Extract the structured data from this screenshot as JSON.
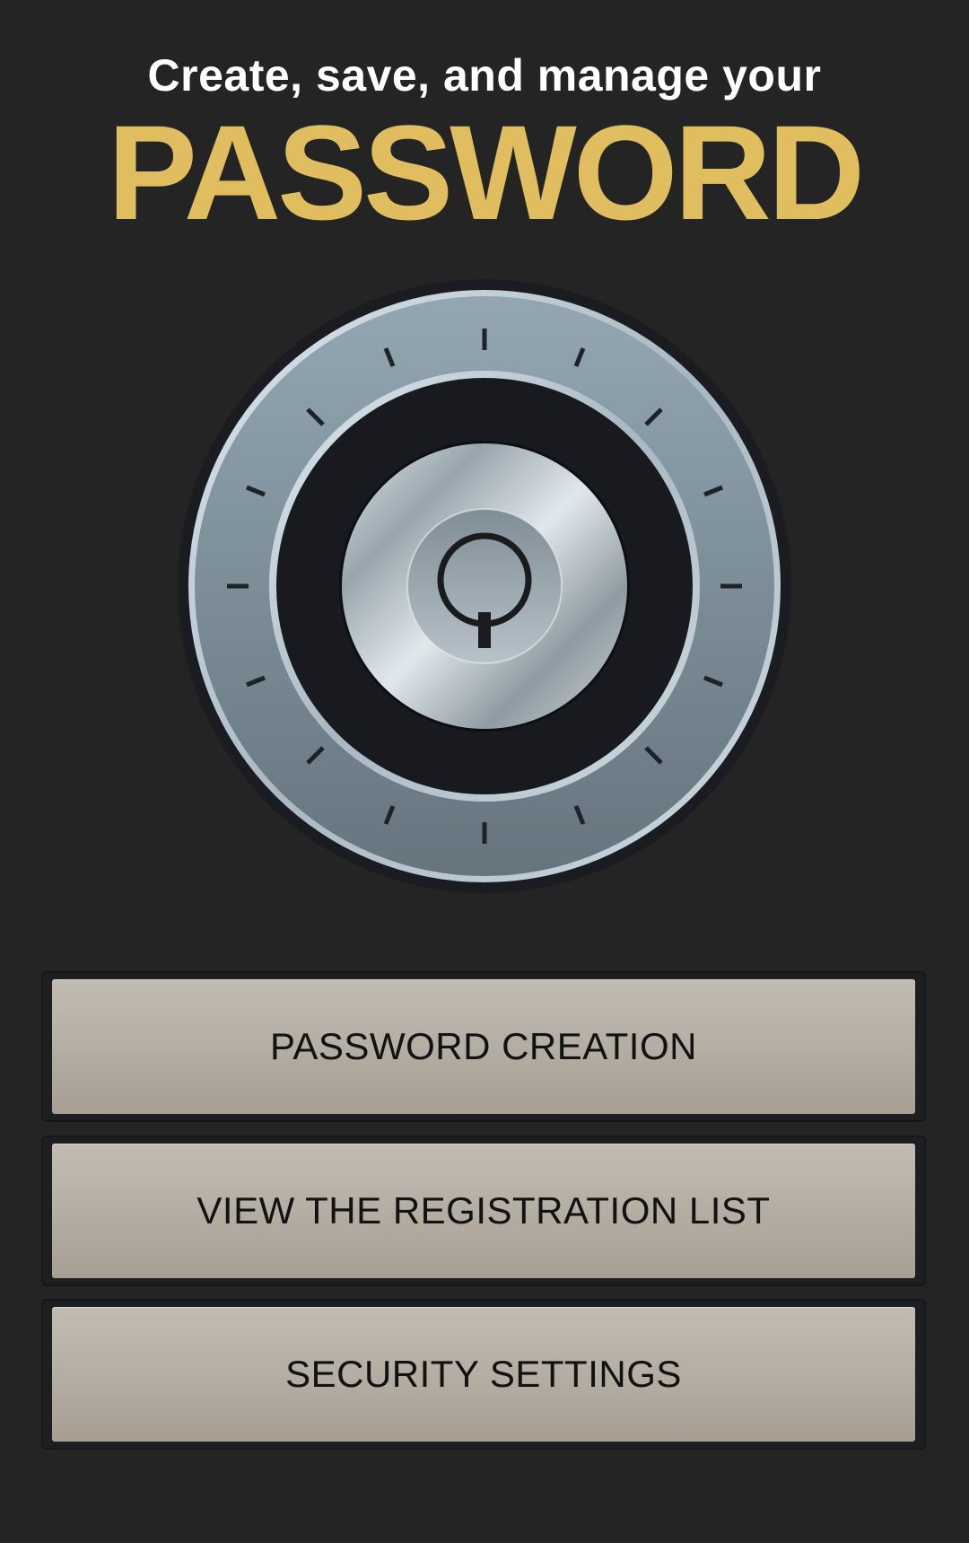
{
  "header": {
    "tagline": "Create, save, and manage your",
    "headline": "PASSWORD"
  },
  "dial": {
    "icon": "combination-lock-dial-icon",
    "center_icon": "power-lock-icon",
    "colors": {
      "outer_ring": "#8c9ea8",
      "inner_dark": "#181a20",
      "knob": "#aeb8be"
    }
  },
  "menu": {
    "items": [
      {
        "label": "PASSWORD CREATION"
      },
      {
        "label": "VIEW THE REGISTRATION LIST"
      },
      {
        "label": "SECURITY SETTINGS"
      }
    ]
  },
  "colors": {
    "background": "#242424",
    "accent": "#e0bd5f",
    "button": "#b8b2a8"
  }
}
